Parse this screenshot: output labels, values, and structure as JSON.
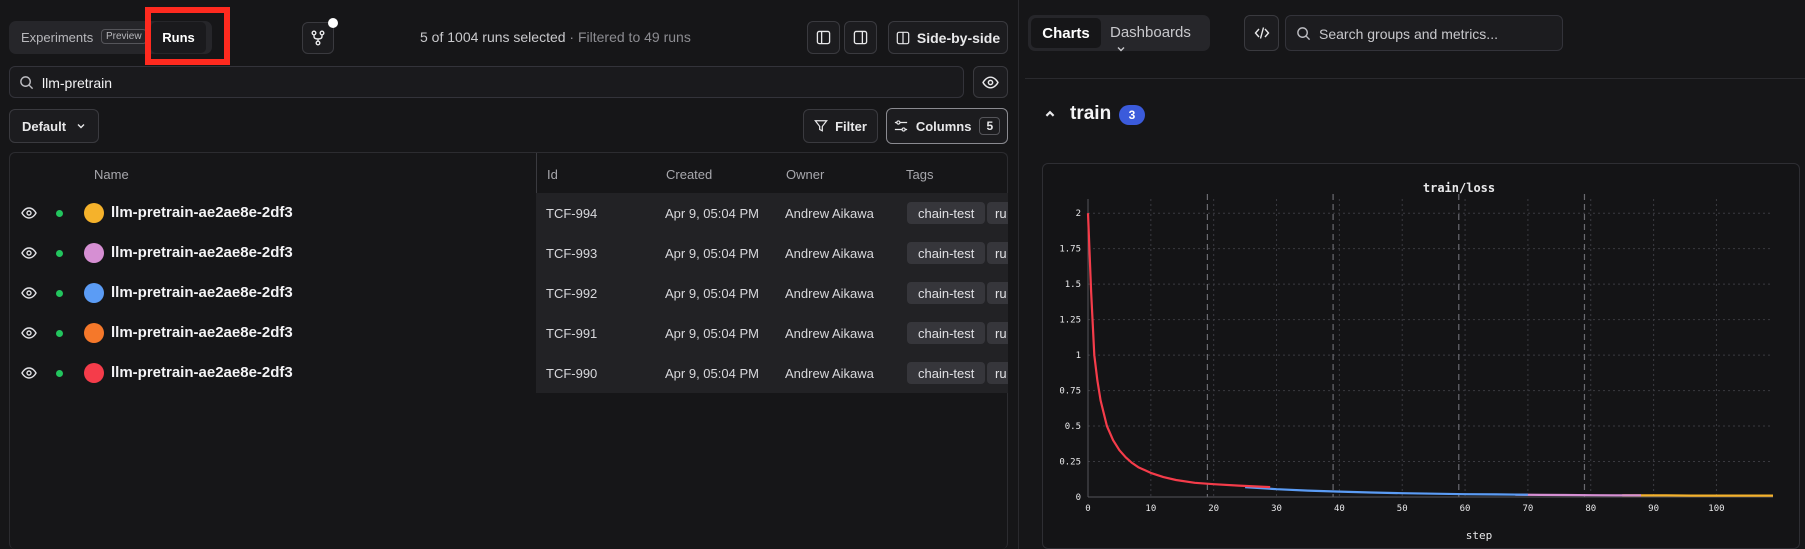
{
  "view_toggle": {
    "experiments_label": "Experiments",
    "preview_badge": "Preview",
    "runs_label": "Runs"
  },
  "status": {
    "selected": "5 of 1004 runs selected",
    "filtered": " · Filtered to 49 runs"
  },
  "toolbar": {
    "side_by_side_label": "Side-by-side",
    "filter_label": "Filter",
    "columns_label": "Columns",
    "columns_count": "5",
    "default_label": "Default"
  },
  "search": {
    "value": "llm-pretrain"
  },
  "table": {
    "headers": {
      "name": "Name",
      "id": "Id",
      "created": "Created",
      "owner": "Owner",
      "tags": "Tags"
    },
    "rows": [
      {
        "name": "llm-pretrain-ae2ae8e-2df3",
        "id": "TCF-994",
        "created": "Apr 9, 05:04 PM",
        "owner": "Andrew Aikawa",
        "tag": "chain-test",
        "tag2": "ru",
        "color": "#f5b22b"
      },
      {
        "name": "llm-pretrain-ae2ae8e-2df3",
        "id": "TCF-993",
        "created": "Apr 9, 05:04 PM",
        "owner": "Andrew Aikawa",
        "tag": "chain-test",
        "tag2": "ru",
        "color": "#d68fd3"
      },
      {
        "name": "llm-pretrain-ae2ae8e-2df3",
        "id": "TCF-992",
        "created": "Apr 9, 05:04 PM",
        "owner": "Andrew Aikawa",
        "tag": "chain-test",
        "tag2": "ru",
        "color": "#5b9cf5"
      },
      {
        "name": "llm-pretrain-ae2ae8e-2df3",
        "id": "TCF-991",
        "created": "Apr 9, 05:04 PM",
        "owner": "Andrew Aikawa",
        "tag": "chain-test",
        "tag2": "ru",
        "color": "#f5782a"
      },
      {
        "name": "llm-pretrain-ae2ae8e-2df3",
        "id": "TCF-990",
        "created": "Apr 9, 05:04 PM",
        "owner": "Andrew Aikawa",
        "tag": "chain-test",
        "tag2": "ru",
        "color": "#f53c4a"
      }
    ]
  },
  "right_tabs": {
    "charts": "Charts",
    "dashboards": "Dashboards"
  },
  "metric_search": {
    "placeholder": "Search groups and metrics..."
  },
  "group": {
    "name": "train",
    "count": "3"
  },
  "chart_data": {
    "type": "line",
    "title": "train/loss",
    "xlabel": "step",
    "ylabel": "",
    "xlim": [
      0,
      109
    ],
    "ylim": [
      0,
      2.1
    ],
    "x_ticks": [
      0,
      10,
      20,
      30,
      40,
      50,
      60,
      70,
      80,
      90,
      100
    ],
    "y_ticks": [
      "0",
      "0.25",
      "0.5",
      "0.75",
      "1",
      "1.25",
      "1.5",
      "1.75",
      "2"
    ],
    "y_tick_values": [
      0,
      0.25,
      0.5,
      0.75,
      1,
      1.25,
      1.5,
      1.75,
      2
    ],
    "vlines": [
      19,
      39,
      59,
      79
    ],
    "series": [
      {
        "color": "#f5b22b",
        "x": [
          85,
          88,
          92,
          96,
          100,
          104,
          109
        ],
        "y": [
          0.012,
          0.011,
          0.011,
          0.01,
          0.01,
          0.01,
          0.01
        ]
      },
      {
        "color": "#d68fd3",
        "x": [
          68,
          72,
          76,
          80,
          84,
          88
        ],
        "y": [
          0.016,
          0.015,
          0.014,
          0.013,
          0.012,
          0.012
        ]
      },
      {
        "color": "#5b9cf5",
        "x": [
          25,
          30,
          35,
          40,
          45,
          50,
          55,
          60,
          65,
          70
        ],
        "y": [
          0.07,
          0.055,
          0.045,
          0.038,
          0.032,
          0.027,
          0.023,
          0.02,
          0.018,
          0.016
        ]
      },
      {
        "color": "#f53c4a",
        "x": [
          0,
          0.5,
          1,
          1.5,
          2,
          3,
          4,
          5,
          6,
          7,
          8,
          10,
          12,
          14,
          17,
          20,
          24,
          29
        ],
        "y": [
          2.0,
          1.45,
          1.0,
          0.82,
          0.68,
          0.5,
          0.4,
          0.33,
          0.28,
          0.24,
          0.21,
          0.17,
          0.14,
          0.12,
          0.1,
          0.09,
          0.08,
          0.07
        ]
      }
    ]
  }
}
